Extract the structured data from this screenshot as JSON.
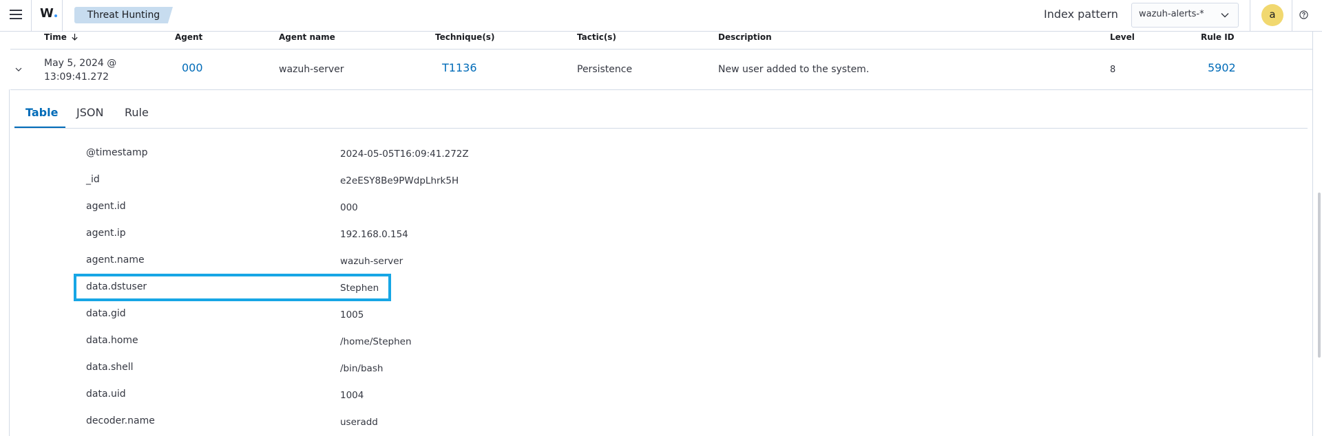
{
  "header": {
    "app_logo": "W",
    "breadcrumb": "Threat Hunting",
    "index_pattern_label": "Index pattern",
    "index_pattern_value": "wazuh-alerts-*",
    "avatar_initial": "a",
    "accent": "#006bb8"
  },
  "table": {
    "columns": [
      "Time",
      "Agent",
      "Agent name",
      "Technique(s)",
      "Tactic(s)",
      "Description",
      "Level",
      "Rule ID"
    ],
    "row": {
      "time_line1": "May 5, 2024 @",
      "time_line2": "13:09:41.272",
      "agent": "000",
      "agent_name": "wazuh-server",
      "technique": "T1136",
      "tactic": "Persistence",
      "description": "New user added to the system.",
      "level": "8",
      "rule_id": "5902"
    }
  },
  "tabs": [
    "Table",
    "JSON",
    "Rule"
  ],
  "details": [
    {
      "field": "@timestamp",
      "value": "2024-05-05T16:09:41.272Z"
    },
    {
      "field": "_id",
      "value": "e2eESY8Be9PWdpLhrk5H"
    },
    {
      "field": "agent.id",
      "value": "000"
    },
    {
      "field": "agent.ip",
      "value": "192.168.0.154"
    },
    {
      "field": "agent.name",
      "value": "wazuh-server"
    },
    {
      "field": "data.dstuser",
      "value": "Stephen"
    },
    {
      "field": "data.gid",
      "value": "1005"
    },
    {
      "field": "data.home",
      "value": "/home/Stephen"
    },
    {
      "field": "data.shell",
      "value": "/bin/bash"
    },
    {
      "field": "data.uid",
      "value": "1004"
    },
    {
      "field": "decoder.name",
      "value": "useradd"
    }
  ]
}
